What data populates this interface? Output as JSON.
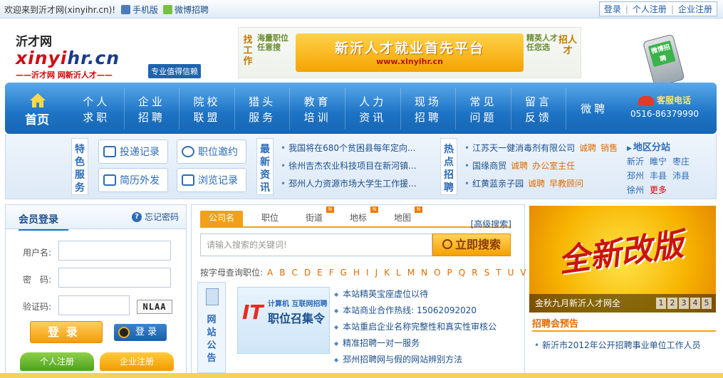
{
  "topbar": {
    "welcome": "欢迎来到沂才网(xinyihr.cn)!",
    "mobile": "手机版",
    "weibo": "微博招聘",
    "links": [
      "登录",
      "个人注册",
      "企业注册"
    ]
  },
  "header": {
    "logo_cn": "沂才网",
    "logo_en_a": "xinyi",
    "logo_en_b": "hr.cn",
    "logo_tagline": "——沂才网 网新沂人才——",
    "badge": "专业值得信赖",
    "banner_left": "找工作",
    "banner_left2": "海量职位 任意搜",
    "banner_main": "新沂人才就业首先平台",
    "banner_url": "www.xinyihr.cn",
    "banner_right2": "精英人才 任您选",
    "banner_right": "招人才",
    "phone_label": "微博招聘"
  },
  "nav": {
    "home": "首页",
    "items": [
      {
        "l1": "个人",
        "l2": "求职"
      },
      {
        "l1": "企业",
        "l2": "招聘"
      },
      {
        "l1": "院校",
        "l2": "联盟"
      },
      {
        "l1": "猎头",
        "l2": "服务"
      },
      {
        "l1": "教育",
        "l2": "培训"
      },
      {
        "l1": "人力",
        "l2": "资讯"
      },
      {
        "l1": "现场",
        "l2": "招聘"
      },
      {
        "l1": "常见",
        "l2": "问题"
      },
      {
        "l1": "留言",
        "l2": "反馈"
      },
      {
        "l1": "微聘",
        "l2": ""
      }
    ],
    "hotline_label": "客服电话",
    "hotline_number": "0516-86379990"
  },
  "subnav": {
    "services_caption": "特色服务",
    "services": [
      "投递记录",
      "职位邀约",
      "简历外发",
      "浏览记录"
    ],
    "news_caption": "最新资讯",
    "news": [
      "我国将在680个贫困县每年定向...",
      "徐州吉杰农业科技项目在新河镇...",
      "邳州人力资源市场大学生工作援..."
    ],
    "hot_caption": "热点招聘",
    "hot": [
      {
        "company": "江苏天一健消毒剂有限公司",
        "jobs": [
          "诚聘",
          "销售"
        ]
      },
      {
        "company": "国缘商贸",
        "jobs": [
          "诚聘",
          "办公室主任"
        ]
      },
      {
        "company": "红黄蓝亲子园",
        "jobs": [
          "诚聘",
          "早教顾问"
        ]
      }
    ],
    "region_title": "地区分站",
    "regions": [
      "新沂",
      "睢宁",
      "枣庄",
      "邳州",
      "丰县",
      "沛县",
      "徐州"
    ],
    "region_more": "更多"
  },
  "login": {
    "title": "会员登录",
    "forgot": "忘记密码",
    "username_label": "用户名:",
    "password_label": "密　码:",
    "captcha_label": "验证码:",
    "captcha_text": "NLAA",
    "login_button": "登录",
    "qq_button": "登 录",
    "reg_person": "个人注册",
    "reg_company": "企业注册"
  },
  "search": {
    "tabs": [
      {
        "label": "公司名",
        "active": true,
        "new": false
      },
      {
        "label": "职位",
        "active": false,
        "new": false
      },
      {
        "label": "街道",
        "active": false,
        "new": true
      },
      {
        "label": "地标",
        "active": false,
        "new": true
      },
      {
        "label": "地图",
        "active": false,
        "new": true
      }
    ],
    "new_badge": "N",
    "advanced": "[高级搜索]",
    "placeholder": "请输入搜索的关键词!",
    "button": "立即搜索",
    "alpha_label": "按字母查询职位:",
    "alpha_letters": "A B C D E F G H I J K L M N O P Q R S T U V W X Y Z",
    "notice_caption": "网站公告",
    "ad_big": "IT",
    "ad_line1": "计算机 互联网招聘",
    "ad_line2": "职位召集令",
    "notices": [
      "本站精英宝座虚位以待",
      "本站商业合作热线: 15062092020",
      "本站重启企业名称完整性和真实性审核公",
      "精准招聘一对一服务",
      "邳州招聘网与假的网站辨别方法"
    ]
  },
  "promo": {
    "headline": "全新改版",
    "caption": "金秋九月新沂人才网全",
    "pages": [
      "1",
      "2",
      "3",
      "4",
      "5"
    ]
  },
  "jobfair": {
    "title": "招聘会预告",
    "item": "新沂市2012年公开招聘事业单位工作人员"
  },
  "colors": {
    "primary": "#1d73c4",
    "accent": "#f2a017",
    "logo_red": "#cc1016"
  }
}
